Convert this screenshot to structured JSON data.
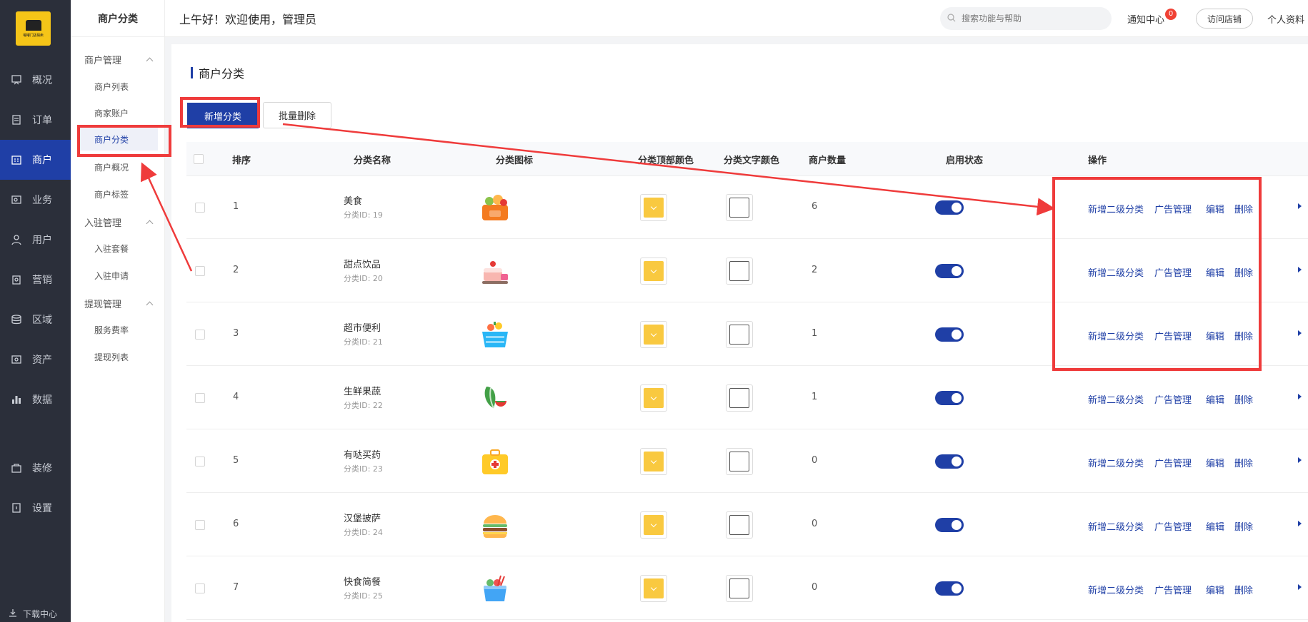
{
  "logo": {
    "text": "嘟嘟门店易卖"
  },
  "nav": {
    "items": [
      {
        "label": "概况",
        "icon": "presentation-icon"
      },
      {
        "label": "订单",
        "icon": "order-icon"
      },
      {
        "label": "商户",
        "icon": "merchant-icon",
        "active": true
      },
      {
        "label": "业务",
        "icon": "business-icon"
      },
      {
        "label": "用户",
        "icon": "user-icon"
      },
      {
        "label": "营销",
        "icon": "marketing-icon"
      },
      {
        "label": "区域",
        "icon": "region-icon"
      },
      {
        "label": "资产",
        "icon": "asset-icon"
      },
      {
        "label": "数据",
        "icon": "chart-icon"
      },
      {
        "label": "装修",
        "icon": "decorate-icon"
      },
      {
        "label": "设置",
        "icon": "settings-icon"
      }
    ],
    "download": "下载中心"
  },
  "sub": {
    "title": "商户分类",
    "groups": [
      {
        "label": "商户管理",
        "items": [
          "商户列表",
          "商家账户",
          "商户分类",
          "商户概况",
          "商户标签"
        ]
      },
      {
        "label": "入驻管理",
        "items": [
          "入驻套餐",
          "入驻申请"
        ]
      },
      {
        "label": "提现管理",
        "items": [
          "服务费率",
          "提现列表"
        ]
      }
    ]
  },
  "header": {
    "greeting": "上午好！欢迎使用，管理员",
    "search_placeholder": "搜索功能与帮助",
    "notif_label": "通知中心",
    "notif_count": "0",
    "visit_label": "访问店铺",
    "profile_label": "个人资料"
  },
  "page": {
    "title": "商户分类",
    "add_label": "新增分类",
    "bulk_delete_label": "批量删除"
  },
  "table": {
    "headers": [
      "排序",
      "分类名称",
      "分类图标",
      "分类顶部颜色",
      "分类文字颜色",
      "商户数量",
      "启用状态",
      "操作"
    ],
    "actions": [
      "新增二级分类",
      "广告管理",
      "编辑",
      "删除"
    ],
    "rows": [
      {
        "sort": "1",
        "name": "美食",
        "sub": "分类ID: 19",
        "icon": "food-basket-icon",
        "count": "6",
        "enabled": true
      },
      {
        "sort": "2",
        "name": "甜点饮品",
        "sub": "分类ID: 20",
        "icon": "cake-drink-icon",
        "count": "2",
        "enabled": true
      },
      {
        "sort": "3",
        "name": "超市便利",
        "sub": "分类ID: 21",
        "icon": "grocery-basket-icon",
        "count": "1",
        "enabled": true
      },
      {
        "sort": "4",
        "name": "生鲜果蔬",
        "sub": "分类ID: 22",
        "icon": "vegetable-icon",
        "count": "1",
        "enabled": true
      },
      {
        "sort": "5",
        "name": "有哒买药",
        "sub": "分类ID: 23",
        "icon": "medicine-kit-icon",
        "count": "0",
        "enabled": true
      },
      {
        "sort": "6",
        "name": "汉堡披萨",
        "sub": "分类ID: 24",
        "icon": "burger-icon",
        "count": "0",
        "enabled": true
      },
      {
        "sort": "7",
        "name": "快食简餐",
        "sub": "分类ID: 25",
        "icon": "fast-food-icon",
        "count": "0",
        "enabled": true
      }
    ]
  },
  "colors": {
    "accent": "#1f3fa6",
    "nav_bg": "#2b2f3a",
    "top_color": "#f9c940",
    "text_color": "#ffffff",
    "annotation": "#ef3b3b"
  }
}
